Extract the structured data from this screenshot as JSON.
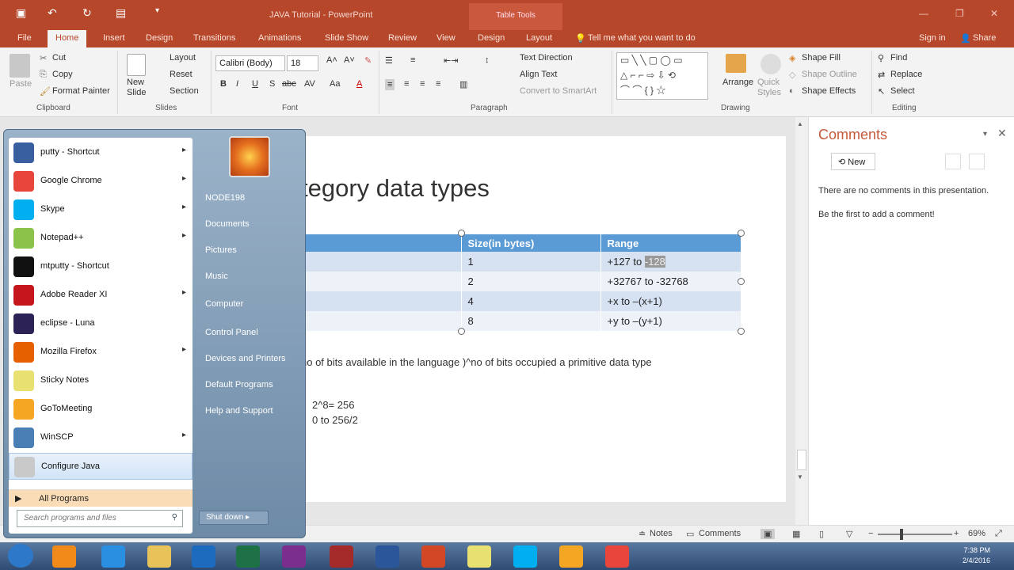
{
  "window": {
    "title": "JAVA Tutorial - PowerPoint",
    "context_tab": "Table Tools",
    "qat_icons": [
      "save-icon",
      "undo-icon",
      "redo-icon",
      "present-icon",
      "customize-icon"
    ],
    "controls": [
      "—",
      "❐",
      "✕"
    ]
  },
  "tabs": [
    {
      "label": "File"
    },
    {
      "label": "Home",
      "active": true
    },
    {
      "label": "Insert"
    },
    {
      "label": "Design"
    },
    {
      "label": "Transitions"
    },
    {
      "label": "Animations"
    },
    {
      "label": "Slide Show"
    },
    {
      "label": "Review"
    },
    {
      "label": "View"
    },
    {
      "label": "Design"
    },
    {
      "label": "Layout"
    }
  ],
  "tell_me": "Tell me what you want to do",
  "sign_in": "Sign in",
  "share": "Share",
  "ribbon": {
    "clipboard": {
      "paste": "Paste",
      "cut": "Cut",
      "copy": "Copy",
      "format_painter": "Format Painter",
      "group": "Clipboard"
    },
    "slides": {
      "new_slide": "New Slide",
      "layout": "Layout",
      "reset": "Reset",
      "section": "Section",
      "group": "Slides"
    },
    "font": {
      "name": "Calibri (Body)",
      "size": "18",
      "group": "Font",
      "bold": "B",
      "italic": "I",
      "underline": "U",
      "shadow": "S",
      "strike": "abc",
      "spacing": "AV",
      "case": "Aa"
    },
    "paragraph": {
      "group": "Paragraph",
      "text_direction": "Text Direction",
      "align_text": "Align Text",
      "smartart": "Convert to SmartArt"
    },
    "drawing": {
      "group": "Drawing",
      "arrange": "Arrange",
      "quick_styles": "Quick Styles",
      "shape_fill": "Shape Fill",
      "shape_outline": "Shape Outline",
      "shape_effects": "Shape Effects"
    },
    "editing": {
      "group": "Editing",
      "find": "Find",
      "replace": "Replace",
      "select": "Select"
    }
  },
  "slide": {
    "title": "tegory data types",
    "table": {
      "headers": [
        "",
        "Size(in bytes)",
        "Range"
      ],
      "rows": [
        [
          "",
          "1",
          "+127 to ",
          "-128"
        ],
        [
          "",
          "2",
          "+32767 to -32768",
          ""
        ],
        [
          "",
          "4",
          "+x to –(x+1)",
          ""
        ],
        [
          "",
          "8",
          "+y to –(y+1)",
          ""
        ]
      ]
    },
    "note": "no of bits available in the language )^no of bits occupied a primitive data type",
    "calc1": "2^8= 256",
    "calc2": "0 to 256/2"
  },
  "comments": {
    "title": "Comments",
    "new": "New",
    "empty1": "There are no comments in this presentation.",
    "empty2": "Be the first to add a comment!"
  },
  "status": {
    "notes": "Notes",
    "comments": "Comments",
    "zoom": "69%",
    "minus": "−",
    "plus": "+"
  },
  "start_menu": {
    "programs": [
      {
        "label": "putty - Shortcut",
        "color": "#3a5fa0",
        "arrow": true
      },
      {
        "label": "Google Chrome",
        "color": "#e8453c",
        "arrow": true
      },
      {
        "label": "Skype",
        "color": "#00aff0",
        "arrow": true
      },
      {
        "label": "Notepad++",
        "color": "#8bc34a",
        "arrow": true
      },
      {
        "label": "mtputty - Shortcut",
        "color": "#111111",
        "arrow": false
      },
      {
        "label": "Adobe Reader XI",
        "color": "#c4161c",
        "arrow": true
      },
      {
        "label": "eclipse - Luna",
        "color": "#2c2255",
        "arrow": false
      },
      {
        "label": "Mozilla Firefox",
        "color": "#e66000",
        "arrow": true
      },
      {
        "label": "Sticky Notes",
        "color": "#e8e070",
        "arrow": false
      },
      {
        "label": "GoToMeeting",
        "color": "#f5a623",
        "arrow": false
      },
      {
        "label": "WinSCP",
        "color": "#4a7fb5",
        "arrow": true
      },
      {
        "label": "Configure Java",
        "color": "#c9c9c9",
        "arrow": false,
        "selected": true
      }
    ],
    "all_programs": "All Programs",
    "search_placeholder": "Search programs and files",
    "right": [
      "NODE198",
      "Documents",
      "Pictures",
      "Music",
      "Computer",
      "Control Panel",
      "Devices and Printers",
      "Default Programs",
      "Help and Support"
    ],
    "shutdown": "Shut down"
  },
  "taskbar": {
    "apps": [
      {
        "name": "start-button",
        "color": "#2d78c8"
      },
      {
        "name": "media-player-icon",
        "color": "#f28a1a"
      },
      {
        "name": "internet-explorer-icon",
        "color": "#2a8fe0"
      },
      {
        "name": "file-explorer-icon",
        "color": "#e8c35a"
      },
      {
        "name": "outlook-icon",
        "color": "#1d6bbf"
      },
      {
        "name": "excel-icon",
        "color": "#1e7145"
      },
      {
        "name": "onenote-icon",
        "color": "#7b2e8d"
      },
      {
        "name": "winrar-icon",
        "color": "#a52a2a"
      },
      {
        "name": "word-icon",
        "color": "#2b579a"
      },
      {
        "name": "powerpoint-icon",
        "color": "#d24726"
      },
      {
        "name": "sticky-notes-icon",
        "color": "#e8e070"
      },
      {
        "name": "skype-icon",
        "color": "#00aff0"
      },
      {
        "name": "gotomeeting-icon",
        "color": "#f5a623"
      },
      {
        "name": "chrome-icon",
        "color": "#e8453c"
      }
    ],
    "time": "7:38 PM",
    "date": "2/4/2016"
  }
}
